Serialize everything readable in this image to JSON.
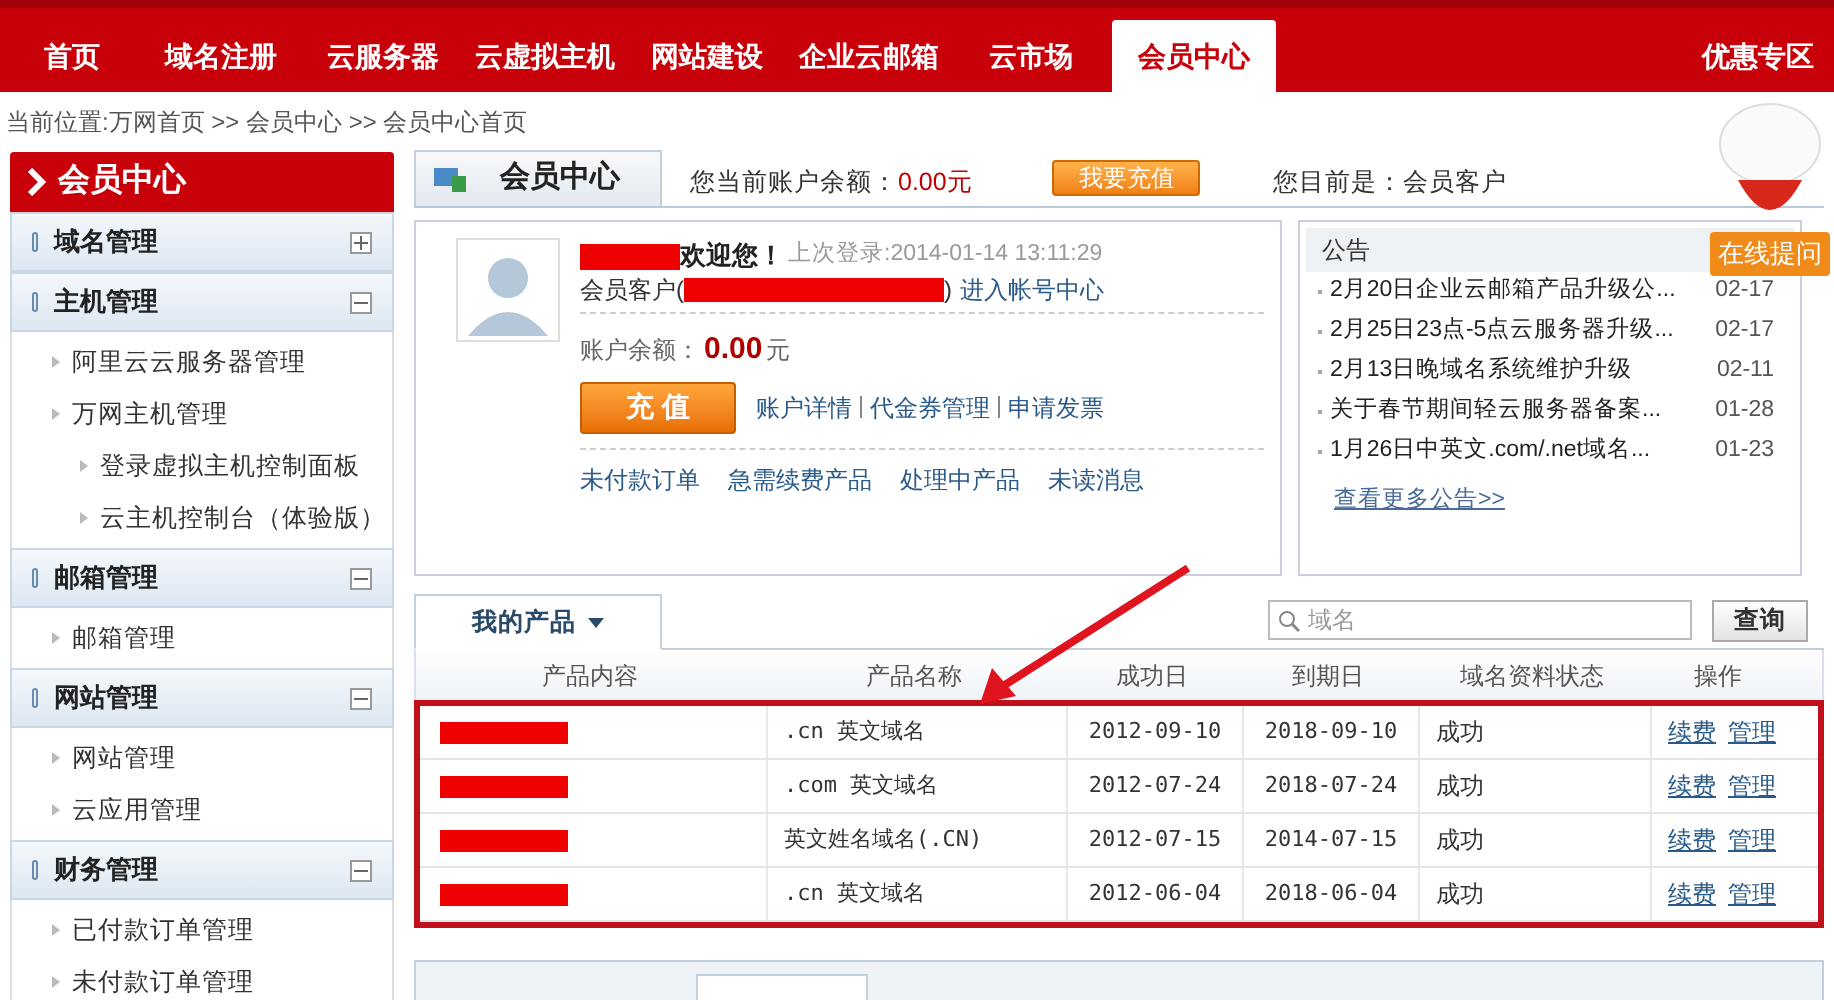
{
  "nav": {
    "items": [
      {
        "label": "首页",
        "selected": false
      },
      {
        "label": "域名注册",
        "selected": false
      },
      {
        "label": "云服务器",
        "selected": false
      },
      {
        "label": "云虚拟主机",
        "selected": false
      },
      {
        "label": "网站建设",
        "selected": false
      },
      {
        "label": "企业云邮箱",
        "selected": false
      },
      {
        "label": "云市场",
        "selected": false
      },
      {
        "label": "会员中心",
        "selected": true
      }
    ],
    "promo": "优惠专区"
  },
  "breadcrumb": "当前位置:万网首页 >> 会员中心 >> 会员中心首页",
  "sidebar": {
    "title": "会员中心",
    "sections": [
      {
        "title": "域名管理",
        "expanded": false
      },
      {
        "title": "主机管理",
        "expanded": true,
        "items": [
          {
            "label": "阿里云云服务器管理"
          },
          {
            "label": "万网主机管理",
            "children": [
              {
                "label": "登录虚拟主机控制面板"
              },
              {
                "label": "云主机控制台（体验版）"
              }
            ]
          }
        ]
      },
      {
        "title": "邮箱管理",
        "expanded": true,
        "items": [
          {
            "label": "邮箱管理"
          }
        ]
      },
      {
        "title": "网站管理",
        "expanded": true,
        "items": [
          {
            "label": "网站管理"
          },
          {
            "label": "云应用管理"
          }
        ]
      },
      {
        "title": "财务管理",
        "expanded": true,
        "items": [
          {
            "label": "已付款订单管理"
          },
          {
            "label": "未付款订单管理"
          }
        ]
      }
    ]
  },
  "header": {
    "tab": "会员中心",
    "balance_label": "您当前账户余额：",
    "balance": "0.00元",
    "recharge_button": "我要充值",
    "role": "您目前是：会员客户"
  },
  "account": {
    "welcome": "欢迎您！",
    "last_login": "上次登录:2014-01-14 13:11:29",
    "member_prefix": "会员客户(",
    "member_suffix": ")",
    "account_link": "进入帐号中心",
    "balance_label": "账户余额：",
    "balance": "0.00",
    "unit": "元",
    "recharge_button": "充 值",
    "links": [
      "账户详情",
      "代金券管理",
      "申请发票"
    ],
    "quick_links": [
      "未付款订单",
      "急需续费产品",
      "处理中产品",
      "未读消息"
    ]
  },
  "notices": {
    "title": "公告",
    "items": [
      {
        "text": "2月20日企业云邮箱产品升级公...",
        "date": "02-17"
      },
      {
        "text": "2月25日23点-5点云服务器升级...",
        "date": "02-17"
      },
      {
        "text": "2月13日晚域名系统维护升级",
        "date": "02-11"
      },
      {
        "text": "关于春节期间轻云服务器备案...",
        "date": "01-28"
      },
      {
        "text": "1月26日中英文.com/.net域名...",
        "date": "01-23"
      }
    ],
    "more": "查看更多公告>>"
  },
  "products": {
    "tab": "我的产品",
    "search_placeholder": "域名",
    "search_button": "查询",
    "columns": [
      "产品内容",
      "产品名称",
      "成功日",
      "到期日",
      "域名资料状态",
      "操作"
    ],
    "rows": [
      {
        "name": ".cn 英文域名",
        "start": "2012-09-10",
        "end": "2018-09-10",
        "status": "成功",
        "actions": [
          "续费",
          "管理"
        ]
      },
      {
        "name": ".com 英文域名",
        "start": "2012-07-24",
        "end": "2018-07-24",
        "status": "成功",
        "actions": [
          "续费",
          "管理"
        ]
      },
      {
        "name": "英文姓名域名(.CN)",
        "start": "2012-07-15",
        "end": "2014-07-15",
        "status": "成功",
        "actions": [
          "续费",
          "管理"
        ]
      },
      {
        "name": ".cn 英文域名",
        "start": "2012-06-04",
        "end": "2018-06-04",
        "status": "成功",
        "actions": [
          "续费",
          "管理"
        ]
      }
    ]
  },
  "helper": {
    "badge": "在线提问"
  }
}
